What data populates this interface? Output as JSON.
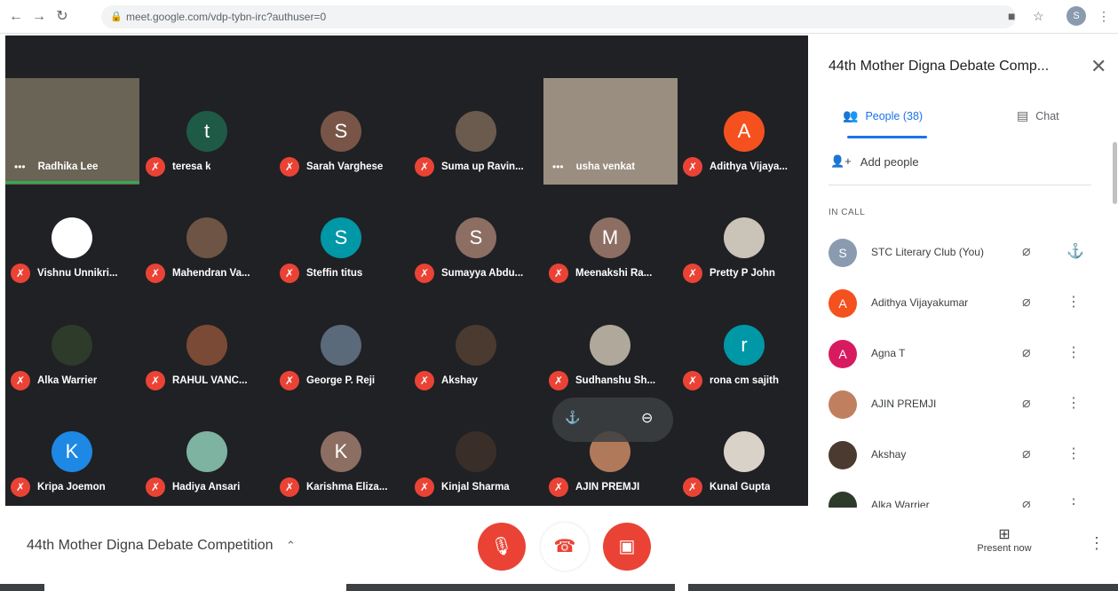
{
  "browser": {
    "url": "meet.google.com/vdp-tybn-irc?authuser=0",
    "back_icon": "←",
    "forward_icon": "→",
    "reload_icon": "↻",
    "profile_initial": "S"
  },
  "tiles": [
    {
      "name": "Radhika Lee",
      "type": "video",
      "video_bg": "#6a6456",
      "speaking": true
    },
    {
      "name": "teresa k",
      "type": "avatar",
      "avatar": "t",
      "color": "#1e5a45"
    },
    {
      "name": "Sarah Varghese",
      "type": "avatar",
      "avatar": "S",
      "color": "#795548"
    },
    {
      "name": "Suma up Ravin...",
      "type": "photo",
      "color": "#6b5a4e"
    },
    {
      "name": "usha venkat",
      "type": "video",
      "video_bg": "#9a8e80"
    },
    {
      "name": "Adithya Vijaya...",
      "type": "avatar",
      "avatar": "A",
      "color": "#f4511e"
    },
    {
      "name": "Vishnu Unnikri...",
      "type": "photo",
      "color": "#ffffff"
    },
    {
      "name": "Mahendran Va...",
      "type": "photo",
      "color": "#6d5444"
    },
    {
      "name": "Steffin titus",
      "type": "avatar",
      "avatar": "S",
      "color": "#0097a7"
    },
    {
      "name": "Sumayya Abdu...",
      "type": "avatar",
      "avatar": "S",
      "color": "#8d6e63"
    },
    {
      "name": "Meenakshi Ra...",
      "type": "avatar",
      "avatar": "M",
      "color": "#8d6e63"
    },
    {
      "name": "Pretty P John",
      "type": "photo",
      "color": "#c9c3b8"
    },
    {
      "name": "Alka Warrier",
      "type": "photo",
      "color": "#2e3b2a"
    },
    {
      "name": "RAHUL VANC...",
      "type": "photo",
      "color": "#7a4a36"
    },
    {
      "name": "George P. Reji",
      "type": "photo",
      "color": "#5a6a7a"
    },
    {
      "name": "Akshay",
      "type": "photo",
      "color": "#4a3a30"
    },
    {
      "name": "Sudhanshu Sh...",
      "type": "photo",
      "color": "#b0a89a"
    },
    {
      "name": "rona cm sajith",
      "type": "avatar",
      "avatar": "r",
      "color": "#0097a7"
    },
    {
      "name": "Kripa Joemon",
      "type": "avatar",
      "avatar": "K",
      "color": "#1e88e5"
    },
    {
      "name": "Hadiya Ansari",
      "type": "photo",
      "color": "#7db3a0"
    },
    {
      "name": "Karishma Eliza...",
      "type": "avatar",
      "avatar": "K",
      "color": "#8d6e63"
    },
    {
      "name": "Kinjal Sharma",
      "type": "photo",
      "color": "#3a2e28"
    },
    {
      "name": "AJIN PREMJI",
      "type": "photo",
      "color": "#b07a5a",
      "hover": true
    },
    {
      "name": "Kunal Gupta",
      "type": "photo",
      "color": "#d8d2c8"
    }
  ],
  "panel": {
    "title": "44th Mother Digna Debate Comp...",
    "tab_people": "People (38)",
    "tab_chat": "Chat",
    "add_people": "Add people",
    "in_call": "IN CALL",
    "participants": [
      {
        "name": "STC Literary Club (You)",
        "avatar": "S",
        "color": "#8a9bb0",
        "you": true
      },
      {
        "name": "Adithya Vijayakumar",
        "avatar": "A",
        "color": "#f4511e"
      },
      {
        "name": "Agna T",
        "avatar": "A",
        "color": "#d81b60"
      },
      {
        "name": "AJIN PREMJI",
        "avatar": "",
        "color": "#c08060"
      },
      {
        "name": "Akshay",
        "avatar": "",
        "color": "#4a3a30"
      },
      {
        "name": "Alka Warrier",
        "avatar": "",
        "color": "#2e3b2a"
      }
    ]
  },
  "bottom": {
    "meeting_title": "44th Mother Digna Debate Competition",
    "present_label": "Present now"
  }
}
